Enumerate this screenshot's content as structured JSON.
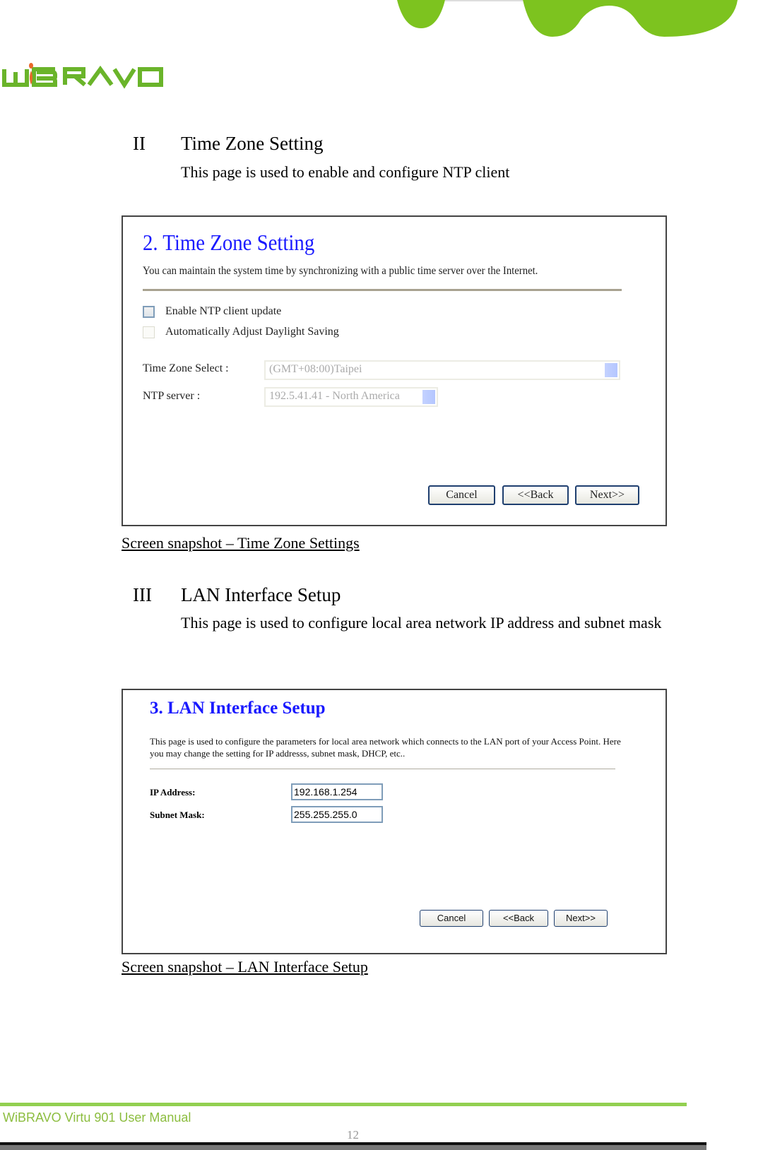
{
  "brand": {
    "logo_text": "WiBRAVO",
    "accent_green": "#7dc31f",
    "logo_dot_color": "#e8692a"
  },
  "sections": [
    {
      "number": "II",
      "title": "Time Zone Setting",
      "description": "This page is used to enable and configure NTP client",
      "snapshot": {
        "title": "2. Time Zone Setting",
        "description": "You can maintain the system time by synchronizing with a public time server over the Internet.",
        "checkboxes": [
          {
            "label": "Enable NTP client update",
            "checked": false,
            "enabled": true
          },
          {
            "label": "Automatically Adjust Daylight Saving",
            "checked": false,
            "enabled": false
          }
        ],
        "fields": [
          {
            "label": "Time Zone Select :",
            "value": "(GMT+08:00)Taipei"
          },
          {
            "label": "NTP server :",
            "value": "192.5.41.41 - North America"
          }
        ],
        "buttons": {
          "cancel": "Cancel",
          "back": "<<Back",
          "next": "Next>>"
        }
      },
      "caption": "Screen snapshot – Time Zone Settings"
    },
    {
      "number": "III",
      "title": "LAN Interface Setup",
      "description": "This page is used to configure local area network IP address and subnet mask",
      "snapshot": {
        "title": "3. LAN Interface Setup",
        "description": "This page is used to configure the parameters for local area network which connects to the LAN port of your Access Point. Here you may change the setting for IP addresss, subnet mask, DHCP, etc..",
        "fields": [
          {
            "label": "IP Address:",
            "value": "192.168.1.254"
          },
          {
            "label": "Subnet Mask:",
            "value": "255.255.255.0"
          }
        ],
        "buttons": {
          "cancel": "Cancel",
          "back": "<<Back",
          "next": "Next>>"
        }
      },
      "caption": "Screen snapshot – LAN Interface Setup"
    }
  ],
  "footer": {
    "manual_title": "WiBRAVO Virtu 901 User Manual",
    "page_number": "12"
  }
}
